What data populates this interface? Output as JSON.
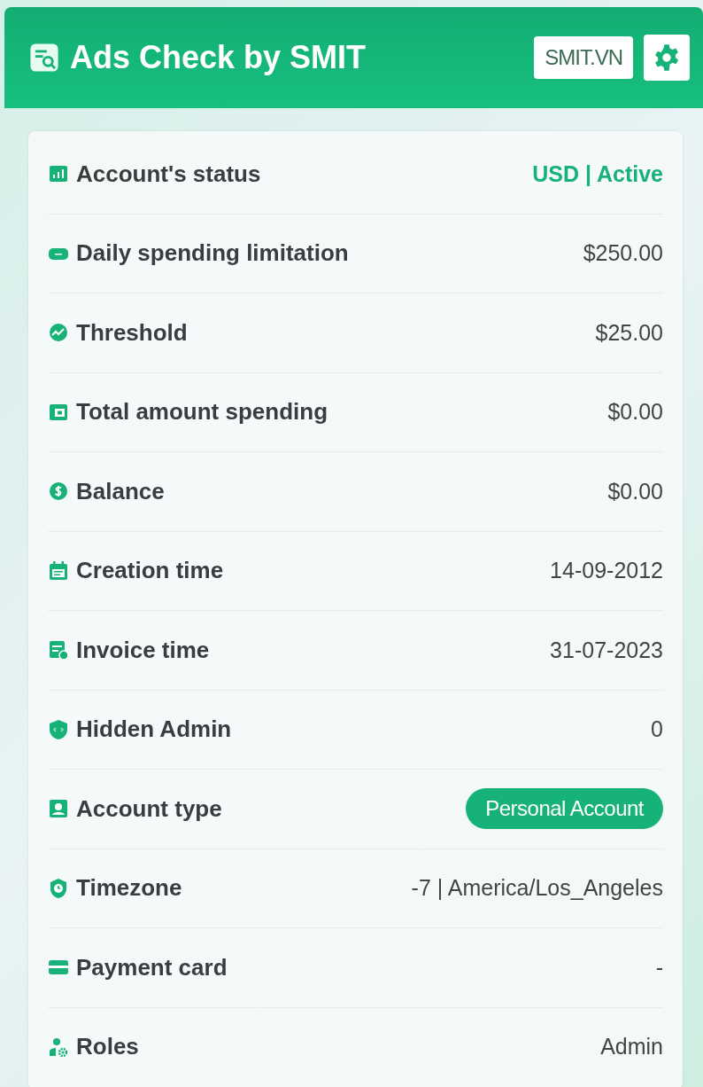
{
  "header": {
    "title": "Ads Check by SMIT",
    "link": "SMIT.VN"
  },
  "rows": [
    {
      "label": "Account's status",
      "value": "USD | Active",
      "kind": "status"
    },
    {
      "label": "Daily spending limitation",
      "value": "$250.00",
      "kind": "text"
    },
    {
      "label": "Threshold",
      "value": "$25.00",
      "kind": "text"
    },
    {
      "label": "Total amount spending",
      "value": "$0.00",
      "kind": "text"
    },
    {
      "label": "Balance",
      "value": "$0.00",
      "kind": "text"
    },
    {
      "label": "Creation time",
      "value": "14-09-2012",
      "kind": "text"
    },
    {
      "label": "Invoice time",
      "value": "31-07-2023",
      "kind": "text"
    },
    {
      "label": "Hidden Admin",
      "value": "0",
      "kind": "text"
    },
    {
      "label": "Account type",
      "value": "Personal Account",
      "kind": "badge"
    },
    {
      "label": "Timezone",
      "value": "-7 | America/Los_Angeles",
      "kind": "text"
    },
    {
      "label": "Payment card",
      "value": "-",
      "kind": "text"
    },
    {
      "label": "Roles",
      "value": "Admin",
      "kind": "text"
    }
  ]
}
